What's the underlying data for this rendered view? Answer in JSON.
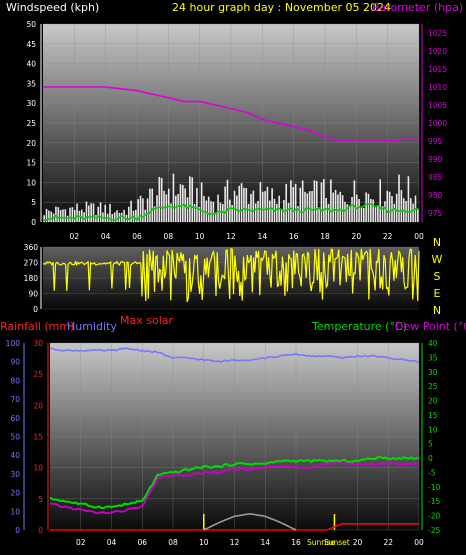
{
  "header": {
    "windspeed_label": "Windspeed (kph)",
    "title": "24 hour graph day : November 05 2024",
    "barometer_label": "Barometer (hpa)"
  },
  "humidity_panel": {
    "rainfall_label": "Rainfall (mm)",
    "humidity_label": "Humidity",
    "max_solar_label": "Max solar",
    "temperature_label": "Temperature (°C)",
    "dewpoint_label": "Dew Point (°C)",
    "sunrise_label": "Sunrise",
    "sunset_label": "Sunset"
  },
  "colors": {
    "wind_gust": "#ffffff",
    "wind_avg": "#00cc00",
    "barometer": "#dd00dd",
    "direction": "#ffff00",
    "humidity": "#7777ff",
    "temperature": "#00dd00",
    "dewpoint": "#cc00cc",
    "rainfall": "#ff0000",
    "solar": "#999999"
  },
  "chart_data": [
    {
      "type": "line",
      "title": "24 hour graph day : November 05 2024",
      "x_ticks": [
        "02",
        "04",
        "06",
        "08",
        "10",
        "12",
        "14",
        "16",
        "18",
        "20",
        "22",
        "00"
      ],
      "y_left_label": "Windspeed (kph)",
      "y_left_ticks": [
        0,
        5,
        10,
        15,
        20,
        25,
        30,
        35,
        40,
        45,
        50
      ],
      "y_left_lim": [
        0,
        50
      ],
      "y_right_label": "Barometer (hpa)",
      "y_right_ticks": [
        975,
        980,
        985,
        990,
        995,
        1000,
        1005,
        1010,
        1015,
        1020,
        1025
      ],
      "y_right_lim": [
        972.5,
        1027.5
      ],
      "series": [
        {
          "name": "Barometer",
          "hours": [
            0,
            1,
            2,
            3,
            4,
            5,
            6,
            7,
            8,
            9,
            10,
            11,
            12,
            13,
            14,
            15,
            16,
            17,
            18,
            19,
            20,
            21,
            22,
            23,
            24
          ],
          "values": [
            1010,
            1010,
            1010,
            1010,
            1010,
            1009.5,
            1009,
            1008,
            1007,
            1006,
            1006,
            1005,
            1004,
            1003,
            1001,
            1000,
            999,
            998,
            996,
            995,
            995,
            995,
            995,
            995.5,
            995.5
          ]
        },
        {
          "name": "Wind gust",
          "hours": [
            0,
            2,
            4,
            5,
            6,
            7,
            8,
            9,
            10,
            11,
            12,
            13,
            14,
            15,
            16,
            17,
            18,
            19,
            20,
            21,
            22,
            23,
            24
          ],
          "values": [
            3,
            4,
            4,
            3,
            5,
            8,
            10,
            10,
            8,
            6,
            9,
            9,
            8,
            7,
            9,
            8,
            9,
            7,
            9,
            8,
            9,
            10,
            7
          ]
        },
        {
          "name": "Wind avg",
          "hours": [
            0,
            2,
            4,
            5,
            6,
            7,
            8,
            9,
            10,
            11,
            12,
            13,
            14,
            15,
            16,
            17,
            18,
            19,
            20,
            21,
            22,
            23,
            24
          ],
          "values": [
            1,
            1,
            1,
            1,
            1,
            3,
            4,
            4,
            3,
            2,
            3,
            3,
            3,
            3,
            3,
            3,
            3,
            3,
            4,
            4,
            3,
            3,
            3
          ]
        }
      ]
    },
    {
      "type": "scatter",
      "title": "",
      "y_left_ticks": [
        0,
        90,
        180,
        270,
        360
      ],
      "y_right_labels": [
        "N",
        "W",
        "S",
        "E",
        "N"
      ],
      "series": [
        {
          "name": "Wind direction",
          "hours": [
            0,
            1,
            2,
            3,
            4,
            5,
            6,
            7,
            8,
            9,
            10,
            11,
            12,
            13,
            14,
            15,
            16,
            17,
            18,
            19,
            20,
            21,
            22,
            23,
            24
          ],
          "values": [
            270,
            270,
            270,
            280,
            280,
            270,
            270,
            150,
            220,
            130,
            240,
            160,
            250,
            200,
            280,
            140,
            230,
            190,
            220,
            150,
            250,
            170,
            240,
            200,
            230
          ]
        }
      ]
    },
    {
      "type": "line",
      "title": "",
      "x_ticks": [
        "02",
        "04",
        "06",
        "08",
        "10",
        "12",
        "14",
        "16",
        "Sunrise",
        "Sunset",
        "20",
        "22",
        "00"
      ],
      "y_left_outer_label": "Humidity",
      "y_left_outer_ticks": [
        0,
        10,
        20,
        30,
        40,
        50,
        60,
        70,
        80,
        90,
        100
      ],
      "y_left_inner_label": "Rainfall (mm)",
      "y_left_inner_ticks": [
        0,
        5,
        10,
        15,
        20,
        25,
        30
      ],
      "y_right_label": "Temperature (°C)",
      "y_right_ticks": [
        -25,
        -20,
        -15,
        -10,
        -5,
        0,
        5,
        10,
        15,
        20,
        25,
        30,
        35,
        40
      ],
      "series": [
        {
          "name": "Humidity",
          "hours": [
            0,
            1,
            2,
            3,
            4,
            5,
            6,
            7,
            8,
            9,
            10,
            11,
            12,
            13,
            14,
            15,
            16,
            17,
            18,
            19,
            20,
            21,
            22,
            23,
            24
          ],
          "values": [
            97,
            96,
            96,
            96,
            96,
            97,
            96,
            95,
            92,
            92,
            91,
            90,
            91,
            91,
            92,
            93,
            94,
            93,
            93,
            92,
            93,
            93,
            92,
            91,
            90
          ]
        },
        {
          "name": "Temperature",
          "hours": [
            0,
            1,
            2,
            3,
            4,
            5,
            6,
            7,
            8,
            9,
            10,
            11,
            12,
            13,
            14,
            15,
            16,
            17,
            18,
            19,
            20,
            21,
            22,
            23,
            24
          ],
          "values": [
            -14,
            -15,
            -16,
            -17,
            -17,
            -16,
            -15,
            -6,
            -5,
            -4,
            -3,
            -3,
            -2,
            -2,
            -2,
            -1,
            -1,
            -1,
            -1,
            -1,
            -1,
            0,
            0,
            0,
            0
          ]
        },
        {
          "name": "Dew Point",
          "hours": [
            0,
            1,
            2,
            3,
            4,
            5,
            6,
            7,
            8,
            9,
            10,
            11,
            12,
            13,
            14,
            15,
            16,
            17,
            18,
            19,
            20,
            21,
            22,
            23,
            24
          ],
          "values": [
            -16,
            -17,
            -18,
            -19,
            -19,
            -18,
            -17,
            -7,
            -6,
            -6,
            -5,
            -5,
            -4,
            -4,
            -3,
            -3,
            -3,
            -3,
            -2,
            -2,
            -2,
            -2,
            -2,
            -2,
            -2
          ]
        },
        {
          "name": "Rainfall",
          "hours": [
            0,
            18,
            19,
            20,
            21,
            22,
            23,
            24
          ],
          "values": [
            0,
            0,
            1,
            1,
            1,
            1,
            1,
            1
          ]
        },
        {
          "name": "Max solar",
          "hours": [
            10,
            11,
            12,
            13,
            14,
            15,
            16
          ],
          "values": [
            0,
            1.2,
            2.2,
            2.6,
            2.2,
            1.2,
            0
          ]
        }
      ]
    }
  ]
}
